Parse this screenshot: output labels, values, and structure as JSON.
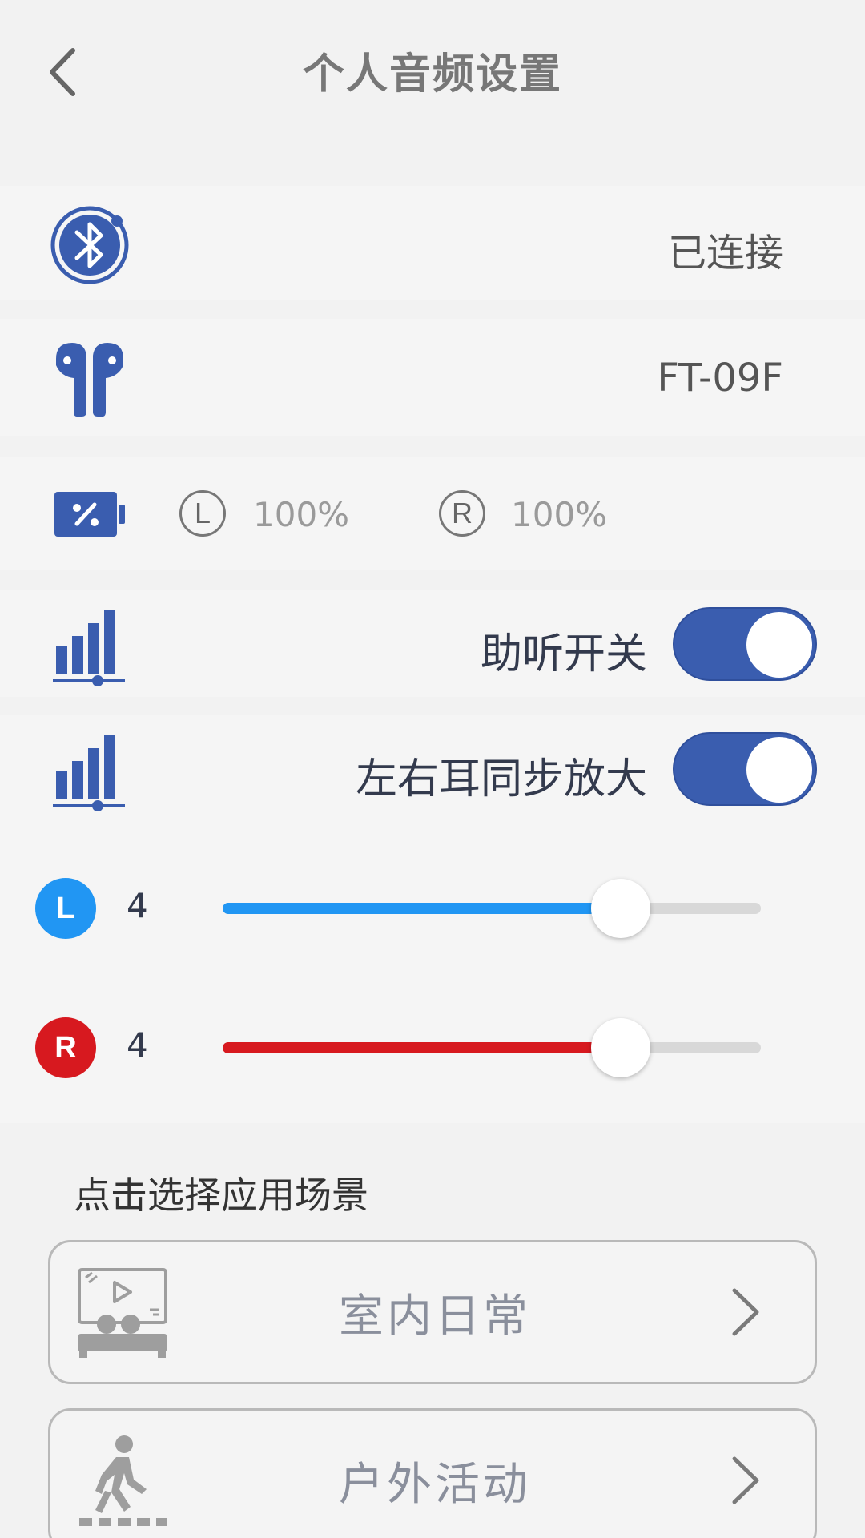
{
  "header": {
    "title": "个人音频设置"
  },
  "colors": {
    "brand_blue": "#3a5daf",
    "left_ear": "#2196f3",
    "right_ear": "#d7191f"
  },
  "connection": {
    "icon": "bluetooth-icon",
    "status": "已连接"
  },
  "device": {
    "icon": "earbuds-icon",
    "name": "FT-09F"
  },
  "battery": {
    "icon": "battery-icon",
    "left_label": "L",
    "left_value": "100%",
    "right_label": "R",
    "right_value": "100%"
  },
  "hearing_aid": {
    "icon": "signal-bars-icon",
    "label": "助听开关",
    "on": true
  },
  "sync_amplify": {
    "icon": "signal-bars-icon",
    "label": "左右耳同步放大",
    "on": true
  },
  "sliders": {
    "left": {
      "badge": "L",
      "value": "4",
      "fraction": 0.74
    },
    "right": {
      "badge": "R",
      "value": "4",
      "fraction": 0.74
    }
  },
  "scenes": {
    "heading": "点击选择应用场景",
    "items": [
      {
        "label": "室内日常",
        "icon": "indoor-theater-icon"
      },
      {
        "label": "户外活动",
        "icon": "walking-person-icon"
      }
    ]
  }
}
